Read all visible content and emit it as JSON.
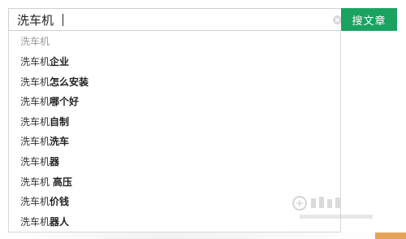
{
  "search": {
    "value": "洗车机",
    "button_label": "搜文章"
  },
  "suggestions": {
    "header": "洗车机",
    "items": [
      {
        "keyword": "洗车机",
        "suffix": "企业"
      },
      {
        "keyword": "洗车机",
        "suffix": "怎么安装"
      },
      {
        "keyword": "洗车机",
        "suffix": "哪个好"
      },
      {
        "keyword": "洗车机",
        "suffix": "自制"
      },
      {
        "keyword": "洗车机",
        "suffix": "洗车"
      },
      {
        "keyword": "洗车机",
        "suffix": "器"
      },
      {
        "keyword": "洗车机 ",
        "suffix": "高压"
      },
      {
        "keyword": "洗车机",
        "suffix": "价钱"
      },
      {
        "keyword": "洗车机",
        "suffix": "器人"
      }
    ]
  },
  "icons": {
    "clear": "close-icon"
  },
  "colors": {
    "button": "#1aa260"
  }
}
